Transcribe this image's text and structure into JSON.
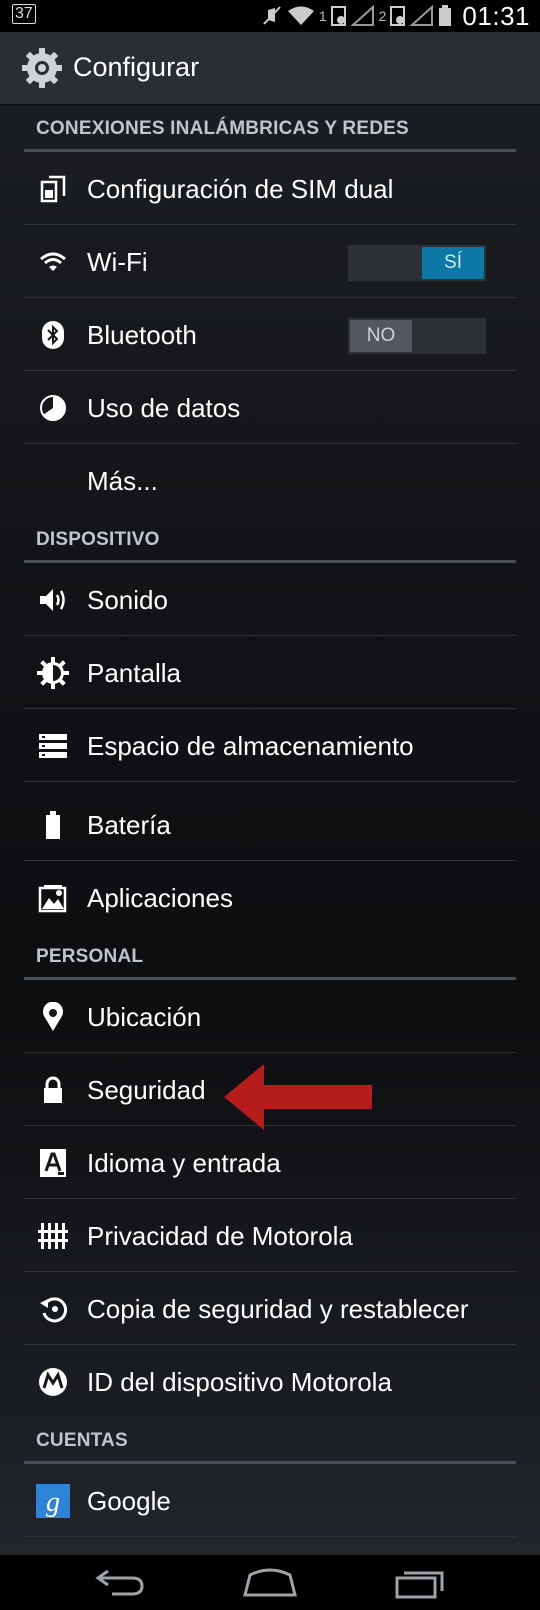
{
  "status_bar": {
    "left_badge": "37",
    "sim1": "1",
    "sim2": "2",
    "time": "01:31"
  },
  "action_bar": {
    "icon": "settings-gear-icon",
    "title": "Configurar"
  },
  "sections": {
    "wireless": {
      "label": "CONEXIONES INALÁMBRICAS Y REDES",
      "items": {
        "sim": {
          "label": "Configuración de SIM dual",
          "icon": "dual-sim-icon"
        },
        "wifi": {
          "label": "Wi-Fi",
          "icon": "wifi-icon",
          "toggle": "SÍ"
        },
        "bluetooth": {
          "label": "Bluetooth",
          "icon": "bluetooth-icon",
          "toggle": "NO"
        },
        "data": {
          "label": "Uso de datos",
          "icon": "data-usage-icon"
        },
        "more": {
          "label": "Más..."
        }
      }
    },
    "device": {
      "label": "DISPOSITIVO",
      "items": {
        "sound": {
          "label": "Sonido",
          "icon": "speaker-icon"
        },
        "display": {
          "label": "Pantalla",
          "icon": "brightness-icon"
        },
        "storage": {
          "label": "Espacio de almacenamiento",
          "icon": "storage-icon"
        },
        "battery": {
          "label": "Batería",
          "icon": "battery-icon"
        },
        "apps": {
          "label": "Aplicaciones",
          "icon": "apps-icon"
        }
      }
    },
    "personal": {
      "label": "PERSONAL",
      "items": {
        "location": {
          "label": "Ubicación",
          "icon": "location-pin-icon"
        },
        "security": {
          "label": "Seguridad",
          "icon": "lock-icon"
        },
        "language": {
          "label": "Idioma y entrada",
          "icon": "keyboard-a-icon"
        },
        "privacy": {
          "label": "Privacidad de Motorola",
          "icon": "privacy-grid-icon"
        },
        "backup": {
          "label": "Copia de seguridad y restablecer",
          "icon": "backup-restore-icon"
        },
        "device_id": {
          "label": "ID del dispositivo Motorola",
          "icon": "motorola-logo-icon"
        }
      }
    },
    "accounts": {
      "label": "CUENTAS",
      "items": {
        "google": {
          "label": "Google",
          "icon": "google-g-icon"
        }
      }
    }
  },
  "annotation": {
    "arrow_color": "#b71c1c"
  },
  "colors": {
    "toggle_on": "#0c78a6",
    "toggle_off": "#54585e",
    "section_text": "#bfc5cc"
  },
  "nav_bar": {
    "back": "back-icon",
    "home": "home-icon",
    "recents": "recents-icon"
  }
}
